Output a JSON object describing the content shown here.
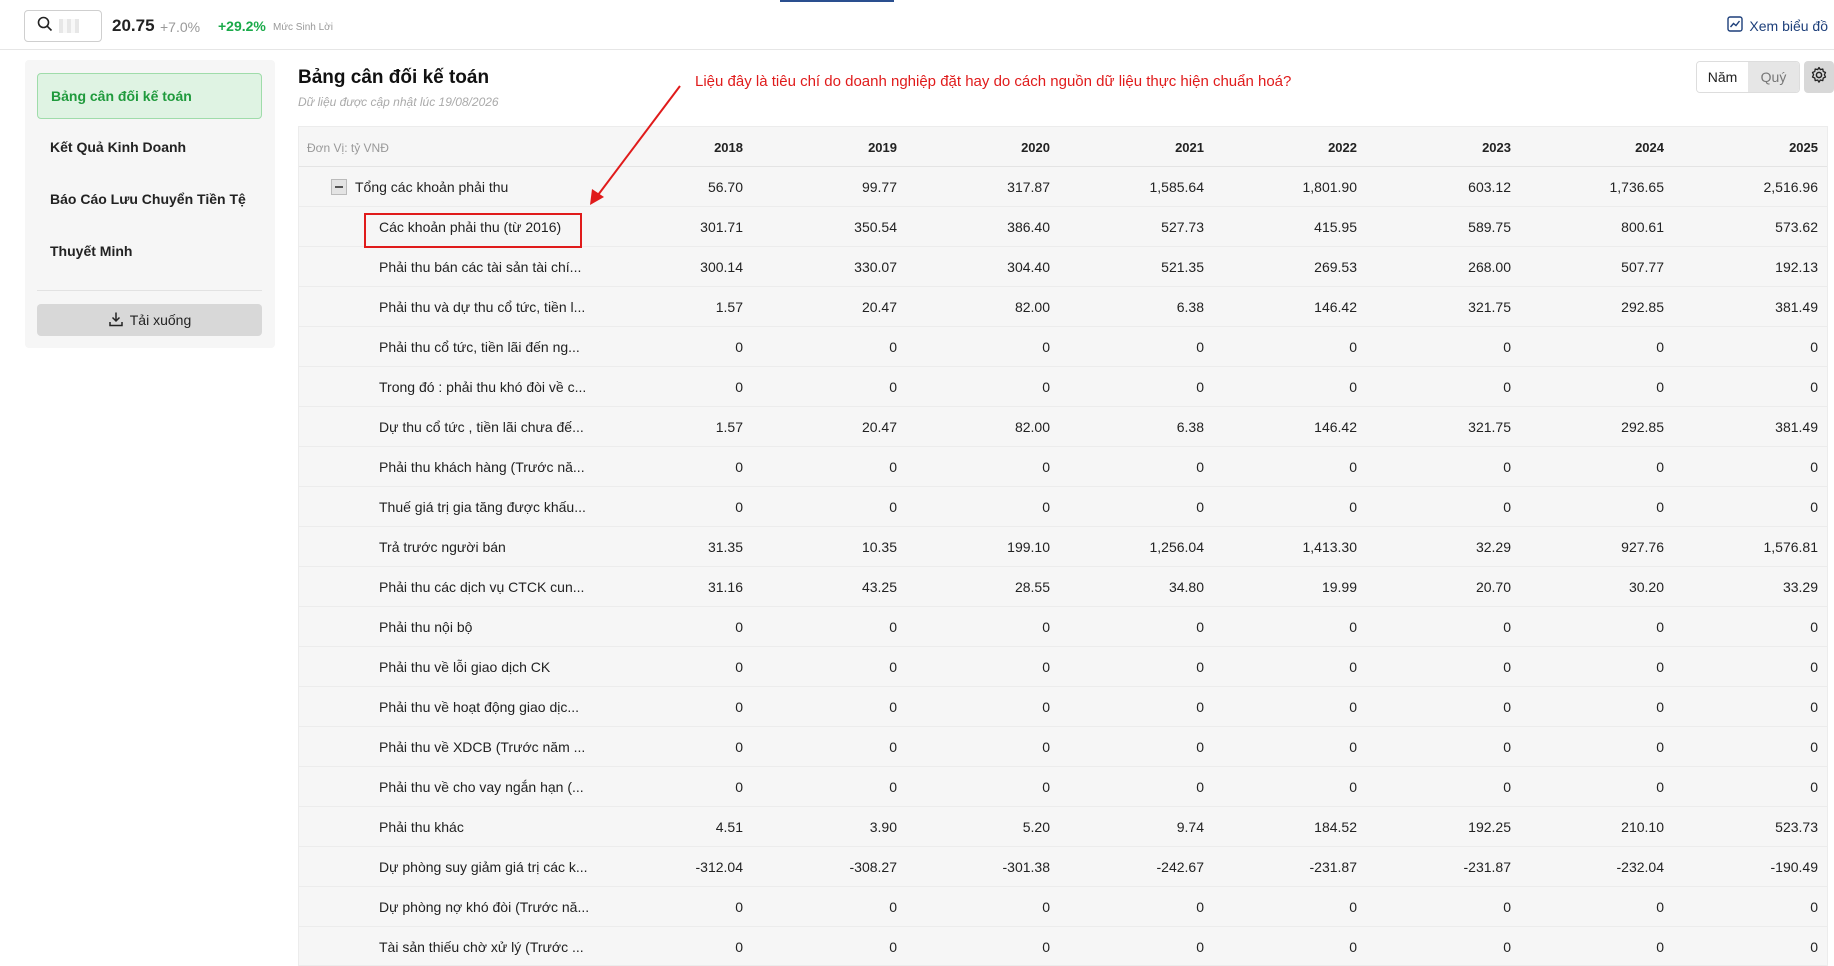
{
  "topbar": {
    "price": "20.75",
    "change": "+7.0%",
    "yield_value": "+29.2%",
    "yield_label": "Mức Sinh Lời",
    "chart_link": "Xem biểu đồ"
  },
  "sidebar": {
    "items": [
      {
        "label": "Bảng cân đối kế toán",
        "active": true
      },
      {
        "label": "Kết Quả Kinh Doanh",
        "active": false
      },
      {
        "label": "Báo Cáo Lưu Chuyển Tiền Tệ",
        "active": false
      },
      {
        "label": "Thuyết Minh",
        "active": false
      }
    ],
    "download_label": "Tải xuống"
  },
  "main": {
    "title": "Bảng cân đối kế toán",
    "subtitle": "Dữ liệu được cập nhật lúc 19/08/2026",
    "annotation": "Liệu đây là tiêu chí do doanh nghiệp đặt hay do cách nguồn dữ liệu thực hiện chuẩn hoá?",
    "period_options": [
      "Năm",
      "Quý"
    ],
    "selected_period": "Năm"
  },
  "table": {
    "unit_label": "Đơn Vị: tỷ VNĐ",
    "years": [
      "2018",
      "2019",
      "2020",
      "2021",
      "2022",
      "2023",
      "2024",
      "2025"
    ],
    "rows": [
      {
        "label": "Tổng các khoản phải thu",
        "level": 0,
        "values": [
          "56.70",
          "99.77",
          "317.87",
          "1,585.64",
          "1,801.90",
          "603.12",
          "1,736.65",
          "2,516.96"
        ]
      },
      {
        "label": "Các khoản phải thu (từ 2016)",
        "level": 1,
        "highlight": true,
        "values": [
          "301.71",
          "350.54",
          "386.40",
          "527.73",
          "415.95",
          "589.75",
          "800.61",
          "573.62"
        ]
      },
      {
        "label": "Phải thu bán các tài sản tài chí...",
        "level": 1,
        "values": [
          "300.14",
          "330.07",
          "304.40",
          "521.35",
          "269.53",
          "268.00",
          "507.77",
          "192.13"
        ]
      },
      {
        "label": "Phải thu và dự thu cổ tức, tiền l...",
        "level": 1,
        "values": [
          "1.57",
          "20.47",
          "82.00",
          "6.38",
          "146.42",
          "321.75",
          "292.85",
          "381.49"
        ]
      },
      {
        "label": "Phải thu cổ tức, tiền lãi đến ng...",
        "level": 1,
        "values": [
          "0",
          "0",
          "0",
          "0",
          "0",
          "0",
          "0",
          "0"
        ]
      },
      {
        "label": "Trong đó : phải thu khó đòi về c...",
        "level": 1,
        "values": [
          "0",
          "0",
          "0",
          "0",
          "0",
          "0",
          "0",
          "0"
        ]
      },
      {
        "label": "Dự thu cổ tức , tiền lãi chưa đế...",
        "level": 1,
        "values": [
          "1.57",
          "20.47",
          "82.00",
          "6.38",
          "146.42",
          "321.75",
          "292.85",
          "381.49"
        ]
      },
      {
        "label": "Phải thu khách hàng (Trước nă...",
        "level": 1,
        "values": [
          "0",
          "0",
          "0",
          "0",
          "0",
          "0",
          "0",
          "0"
        ]
      },
      {
        "label": "Thuế giá trị gia tăng được khấu...",
        "level": 1,
        "values": [
          "0",
          "0",
          "0",
          "0",
          "0",
          "0",
          "0",
          "0"
        ]
      },
      {
        "label": "Trả trước người bán",
        "level": 1,
        "values": [
          "31.35",
          "10.35",
          "199.10",
          "1,256.04",
          "1,413.30",
          "32.29",
          "927.76",
          "1,576.81"
        ]
      },
      {
        "label": "Phải thu các dịch vụ CTCK cun...",
        "level": 1,
        "values": [
          "31.16",
          "43.25",
          "28.55",
          "34.80",
          "19.99",
          "20.70",
          "30.20",
          "33.29"
        ]
      },
      {
        "label": "Phải thu nội bộ",
        "level": 1,
        "values": [
          "0",
          "0",
          "0",
          "0",
          "0",
          "0",
          "0",
          "0"
        ]
      },
      {
        "label": "Phải thu về lỗi giao dịch CK",
        "level": 1,
        "values": [
          "0",
          "0",
          "0",
          "0",
          "0",
          "0",
          "0",
          "0"
        ]
      },
      {
        "label": "Phải thu về hoạt động giao dịc...",
        "level": 1,
        "values": [
          "0",
          "0",
          "0",
          "0",
          "0",
          "0",
          "0",
          "0"
        ]
      },
      {
        "label": "Phải thu về XDCB (Trước năm ...",
        "level": 1,
        "values": [
          "0",
          "0",
          "0",
          "0",
          "0",
          "0",
          "0",
          "0"
        ]
      },
      {
        "label": "Phải thu về cho vay ngắn hạn (...",
        "level": 1,
        "values": [
          "0",
          "0",
          "0",
          "0",
          "0",
          "0",
          "0",
          "0"
        ]
      },
      {
        "label": "Phải thu khác",
        "level": 1,
        "values": [
          "4.51",
          "3.90",
          "5.20",
          "9.74",
          "184.52",
          "192.25",
          "210.10",
          "523.73"
        ]
      },
      {
        "label": "Dự phòng suy giảm giá trị các k...",
        "level": 1,
        "values": [
          "-312.04",
          "-308.27",
          "-301.38",
          "-242.67",
          "-231.87",
          "-231.87",
          "-232.04",
          "-190.49"
        ]
      },
      {
        "label": "Dự phòng nợ khó đòi (Trước nă...",
        "level": 1,
        "values": [
          "0",
          "0",
          "0",
          "0",
          "0",
          "0",
          "0",
          "0"
        ]
      },
      {
        "label": "Tài sản thiếu chờ xử lý (Trước ...",
        "level": 1,
        "values": [
          "0",
          "0",
          "0",
          "0",
          "0",
          "0",
          "0",
          "0"
        ]
      }
    ]
  }
}
